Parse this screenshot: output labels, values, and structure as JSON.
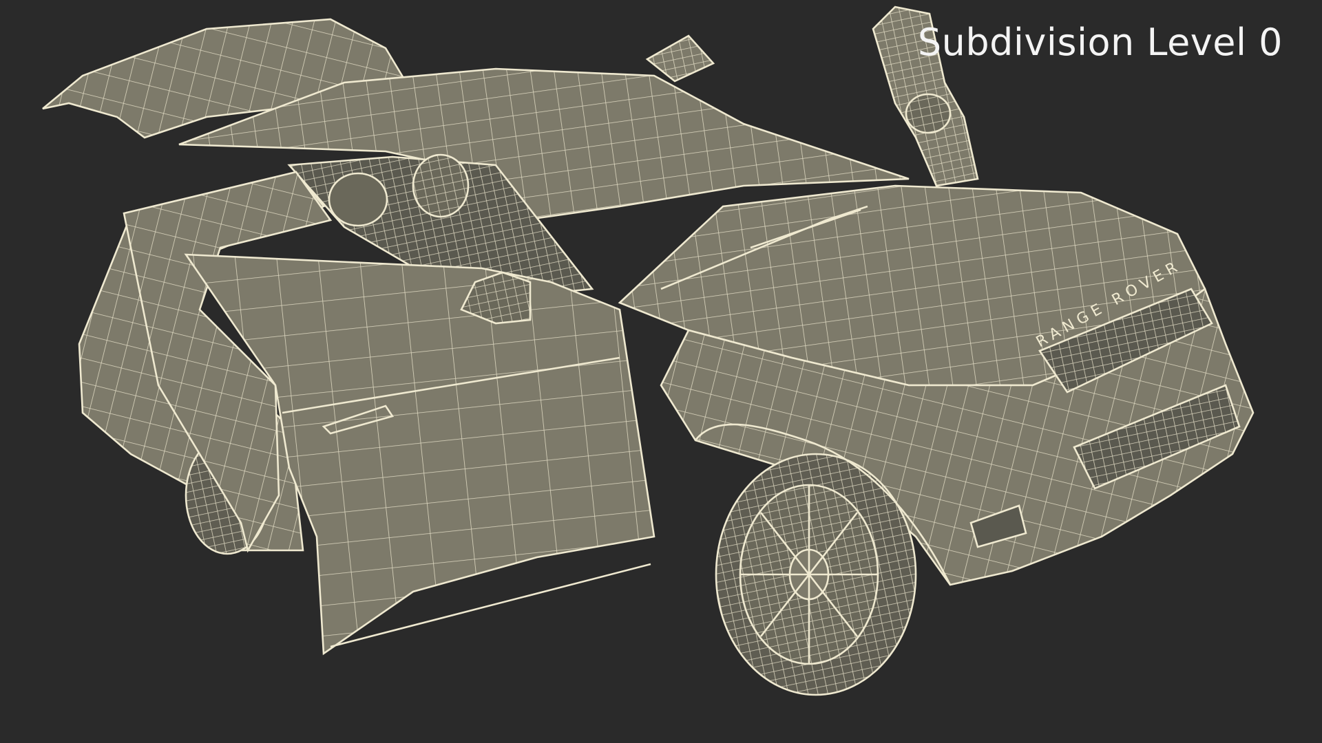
{
  "viewport": {
    "label": "Subdivision Level 0",
    "background_color": "#2a2a2a",
    "mesh_color": "#7d7a6a",
    "wire_color": "#efe9d0"
  },
  "model": {
    "hood_badge": "RANGE ROVER"
  }
}
